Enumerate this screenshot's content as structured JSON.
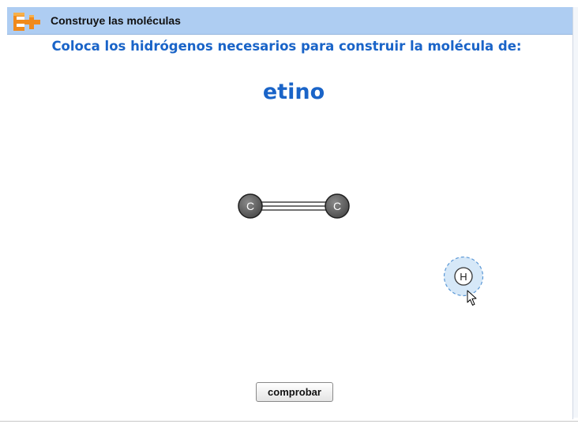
{
  "header": {
    "title": "Construye las moléculas",
    "logo_icon": "plus-logo-icon"
  },
  "task": {
    "instruction": "Coloca los hidrógenos necesarios para construir la molécula de:",
    "molecule_name": "etino"
  },
  "molecule": {
    "atoms": [
      {
        "symbol": "C",
        "kind": "carbon"
      },
      {
        "symbol": "C",
        "kind": "carbon"
      }
    ],
    "bond": "triple"
  },
  "palette": {
    "hydrogen_symbol": "H"
  },
  "actions": {
    "check_label": "comprobar"
  },
  "colors": {
    "header_bg": "#aecdf2",
    "accent_text": "#1a64c8",
    "carbon_fill": "#5a5a5a",
    "hydrogen_halo": "#d6e8f8",
    "logo_orange": "#f08a1c"
  }
}
